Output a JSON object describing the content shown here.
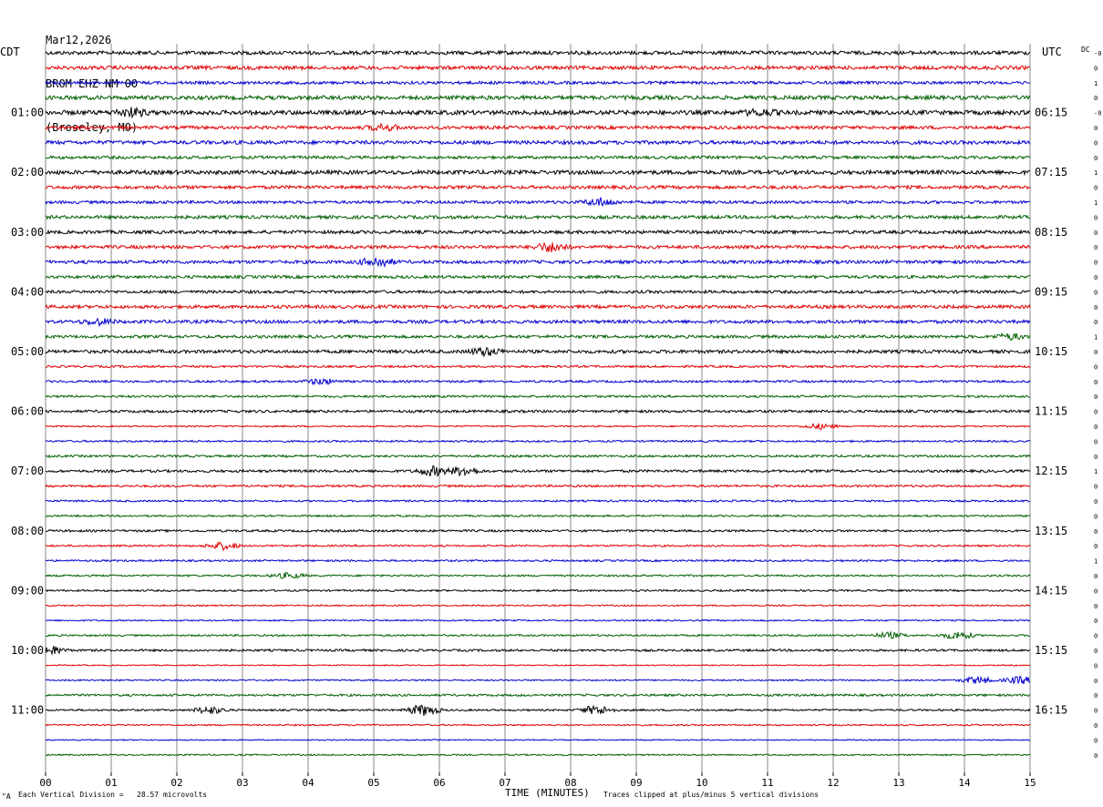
{
  "header": {
    "date": "Mar12,2026",
    "station": "BROM EHZ NM 00",
    "location": "(Broseley, MO)"
  },
  "left_timezone": "CDT",
  "right_timezone": "UTC",
  "dc_label": "DC",
  "footer": {
    "scale_note": "Each Vertical Division =   28.57 microvolts",
    "xlabel": "TIME (MINUTES)",
    "clip_note": "Traces clipped at plus/minus 5 vertical divisions",
    "corner_mark": "\"A"
  },
  "colors": {
    "black": "#000000",
    "red": "#e00000",
    "blue": "#0000d0",
    "green": "#006000",
    "grid": "#888888"
  },
  "chart_data": {
    "type": "line",
    "xlabel": "TIME (MINUTES)",
    "xlim": [
      0,
      15
    ],
    "x_ticks": [
      "00",
      "01",
      "02",
      "03",
      "04",
      "05",
      "06",
      "07",
      "08",
      "09",
      "10",
      "11",
      "12",
      "13",
      "14",
      "15"
    ],
    "trace_color_cycle": [
      "black",
      "red",
      "blue",
      "green"
    ],
    "num_traces": 48,
    "minutes_per_trace": 15,
    "left_hour_labels": [
      {
        "trace": 4,
        "label": "01:00"
      },
      {
        "trace": 8,
        "label": "02:00"
      },
      {
        "trace": 12,
        "label": "03:00"
      },
      {
        "trace": 16,
        "label": "04:00"
      },
      {
        "trace": 20,
        "label": "05:00"
      },
      {
        "trace": 24,
        "label": "06:00"
      },
      {
        "trace": 28,
        "label": "07:00"
      },
      {
        "trace": 32,
        "label": "08:00"
      },
      {
        "trace": 36,
        "label": "09:00"
      },
      {
        "trace": 40,
        "label": "10:00"
      },
      {
        "trace": 44,
        "label": "11:00"
      }
    ],
    "right_hour_labels": [
      {
        "trace": 4,
        "label": "06:15"
      },
      {
        "trace": 8,
        "label": "07:15"
      },
      {
        "trace": 12,
        "label": "08:15"
      },
      {
        "trace": 16,
        "label": "09:15"
      },
      {
        "trace": 20,
        "label": "10:15"
      },
      {
        "trace": 24,
        "label": "11:15"
      },
      {
        "trace": 28,
        "label": "12:15"
      },
      {
        "trace": 32,
        "label": "13:15"
      },
      {
        "trace": 36,
        "label": "14:15"
      },
      {
        "trace": 40,
        "label": "15:15"
      },
      {
        "trace": 44,
        "label": "16:15"
      }
    ],
    "dc_offsets": [
      "-0",
      "0",
      "1",
      "0",
      "-0",
      "0",
      "0",
      "0",
      "1",
      "0",
      "1",
      "0",
      "0",
      "0",
      "0",
      "0",
      "0",
      "0",
      "0",
      "1",
      "0",
      "0",
      "0",
      "0",
      "0",
      "0",
      "0",
      "0",
      "1",
      "0",
      "0",
      "0",
      "0",
      "0",
      "1",
      "0",
      "0",
      "0",
      "0",
      "0",
      "0",
      "0",
      "0",
      "0",
      "0",
      "0",
      "0",
      "0"
    ],
    "amplitude_levels": [
      2,
      2,
      1.6,
      2.2,
      2.4,
      1.8,
      2,
      1.6,
      2.2,
      1.8,
      1.6,
      1.8,
      1.8,
      1.8,
      1.8,
      1.6,
      1.6,
      1.8,
      1.8,
      1.6,
      1.8,
      1.2,
      1.2,
      1.2,
      1.4,
      0.8,
      1,
      1.2,
      1.4,
      1.2,
      1,
      1,
      1.2,
      1,
      1,
      1,
      1,
      0.8,
      0.8,
      1,
      1.2,
      0.6,
      0.8,
      1.2,
      1,
      0.8,
      0.6,
      0.8
    ],
    "events": [
      {
        "trace": 4,
        "minute": 1.3,
        "amp": 4
      },
      {
        "trace": 4,
        "minute": 10.9,
        "amp": 3
      },
      {
        "trace": 5,
        "minute": 5.15,
        "amp": 3
      },
      {
        "trace": 10,
        "minute": 8.45,
        "amp": 4
      },
      {
        "trace": 13,
        "minute": 7.7,
        "amp": 5
      },
      {
        "trace": 14,
        "minute": 5.05,
        "amp": 5
      },
      {
        "trace": 18,
        "minute": 0.8,
        "amp": 3
      },
      {
        "trace": 19,
        "minute": 14.7,
        "amp": 3
      },
      {
        "trace": 20,
        "minute": 6.7,
        "amp": 4
      },
      {
        "trace": 22,
        "minute": 4.2,
        "amp": 3
      },
      {
        "trace": 25,
        "minute": 11.8,
        "amp": 3
      },
      {
        "trace": 28,
        "minute": 5.9,
        "amp": 5
      },
      {
        "trace": 28,
        "minute": 6.35,
        "amp": 5
      },
      {
        "trace": 33,
        "minute": 2.7,
        "amp": 4
      },
      {
        "trace": 35,
        "minute": 3.7,
        "amp": 3
      },
      {
        "trace": 39,
        "minute": 12.85,
        "amp": 3
      },
      {
        "trace": 39,
        "minute": 13.9,
        "amp": 4
      },
      {
        "trace": 40,
        "minute": 0.05,
        "amp": 5
      },
      {
        "trace": 42,
        "minute": 14.2,
        "amp": 4
      },
      {
        "trace": 42,
        "minute": 14.85,
        "amp": 4
      },
      {
        "trace": 44,
        "minute": 2.5,
        "amp": 4
      },
      {
        "trace": 44,
        "minute": 5.75,
        "amp": 6
      },
      {
        "trace": 44,
        "minute": 8.4,
        "amp": 5
      }
    ]
  }
}
